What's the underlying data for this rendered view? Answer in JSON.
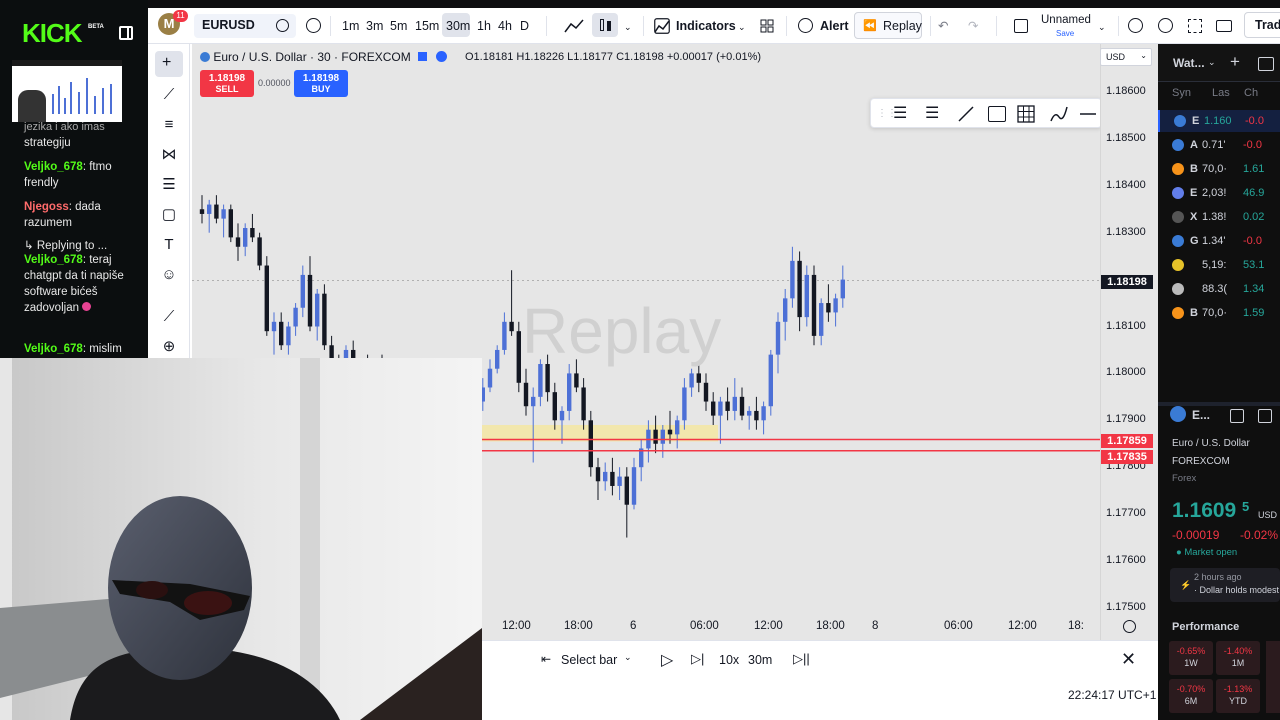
{
  "kick": {
    "logo": "KICK",
    "beta": "BETA",
    "cut_text": "jezika i ako imas",
    "messages": [
      {
        "text": "strategiju"
      },
      {
        "user": "Veljko_678",
        "text": ": ftmo frendly"
      },
      {
        "user": "Njegoss",
        "text": ": dada razumem"
      },
      {
        "reply": "Replying to ..."
      },
      {
        "user": "Veljko_678",
        "text": ": teraj chatgpt da ti napiše software bićeš zadovoljan"
      },
      {
        "user": "Veljko_678",
        "text": ": mislim"
      }
    ],
    "colors": {
      "accent": "#53fc18",
      "user_green": "#53fc18",
      "user_red": "#ff6b6b"
    }
  },
  "topbar": {
    "avatar": "M",
    "notifications": "11",
    "symbol": "EURUSD",
    "timeframes": [
      "1m",
      "3m",
      "5m",
      "15m",
      "30m",
      "1h",
      "4h",
      "D"
    ],
    "active_timeframe": "30m",
    "indicators": "Indicators",
    "alert": "Alert",
    "replay": "Replay",
    "layout_name": "Unnamed",
    "layout_save": "Save",
    "trade": "Trade"
  },
  "chart": {
    "title": "Euro / U.S. Dollar · 30 · FOREXCOM",
    "ohlc": "O1.18181 H1.18226 L1.18177 C1.18198 +0.00017 (+0.01%)",
    "sell_price": "1.18198",
    "sell_label": "SELL",
    "buy_price": "1.18198",
    "buy_label": "BUY",
    "spread": "0.00000",
    "watermark": "Replay",
    "currency": "USD",
    "current_price": "1.18198",
    "line1": "1.17859",
    "line2": "1.17835",
    "price_ticks": [
      "1.18600",
      "1.18500",
      "1.18400",
      "1.18300",
      "1.18100",
      "1.18000",
      "1.17900",
      "1.17800",
      "1.17700",
      "1.17600",
      "1.17500"
    ],
    "time_ticks": [
      "12:00",
      "18:00",
      "6",
      "06:00",
      "12:00",
      "18:00",
      "8",
      "06:00",
      "12:00",
      "18:"
    ]
  },
  "chart_data": {
    "type": "candlestick",
    "title": "Euro / U.S. Dollar · 30 · FOREXCOM",
    "ylim": [
      1.175,
      1.1868
    ],
    "current": 1.18198,
    "horizontal_lines": [
      1.17859,
      1.17835
    ],
    "zone": [
      1.17855,
      1.1789
    ],
    "candles": [
      [
        1.1835,
        1.1838,
        1.1832,
        1.1834
      ],
      [
        1.1834,
        1.1837,
        1.183,
        1.1836
      ],
      [
        1.1836,
        1.1838,
        1.1832,
        1.1833
      ],
      [
        1.1833,
        1.1836,
        1.1829,
        1.1835
      ],
      [
        1.1835,
        1.1836,
        1.1828,
        1.1829
      ],
      [
        1.1829,
        1.1832,
        1.1824,
        1.1827
      ],
      [
        1.1827,
        1.1832,
        1.1825,
        1.1831
      ],
      [
        1.1831,
        1.1834,
        1.1828,
        1.1829
      ],
      [
        1.1829,
        1.183,
        1.1822,
        1.1823
      ],
      [
        1.1823,
        1.1825,
        1.1808,
        1.1809
      ],
      [
        1.1809,
        1.1813,
        1.1804,
        1.1811
      ],
      [
        1.1811,
        1.1813,
        1.1805,
        1.1806
      ],
      [
        1.1806,
        1.1811,
        1.1804,
        1.181
      ],
      [
        1.181,
        1.1815,
        1.1808,
        1.1814
      ],
      [
        1.1814,
        1.1823,
        1.1812,
        1.1821
      ],
      [
        1.1821,
        1.1825,
        1.1809,
        1.181
      ],
      [
        1.181,
        1.1818,
        1.1807,
        1.1817
      ],
      [
        1.1817,
        1.1819,
        1.1805,
        1.1806
      ],
      [
        1.1806,
        1.1808,
        1.18,
        1.1802
      ],
      [
        1.1802,
        1.1804,
        1.1797,
        1.1799
      ],
      [
        1.1799,
        1.1806,
        1.1798,
        1.1805
      ],
      [
        1.1805,
        1.1807,
        1.1799,
        1.18
      ],
      [
        1.18,
        1.1802,
        1.1796,
        1.1801
      ],
      [
        1.1801,
        1.1804,
        1.1797,
        1.1798
      ],
      [
        1.1798,
        1.1803,
        1.1796,
        1.1802
      ],
      [
        1.1802,
        1.1804,
        1.1797,
        1.1799
      ],
      [
        1.1799,
        1.1802,
        1.1795,
        1.1801
      ],
      [
        1.1801,
        1.1803,
        1.1797,
        1.1798
      ],
      [
        1.1798,
        1.1801,
        1.1796,
        1.18
      ],
      [
        1.18,
        1.1802,
        1.1797,
        1.1799
      ],
      [
        1.1799,
        1.18,
        1.1791,
        1.1792
      ],
      [
        1.1792,
        1.1795,
        1.1788,
        1.1794
      ],
      [
        1.1794,
        1.1795,
        1.1789,
        1.179
      ],
      [
        1.179,
        1.1792,
        1.178,
        1.1781
      ],
      [
        1.1781,
        1.179,
        1.178,
        1.1789
      ],
      [
        1.1789,
        1.1799,
        1.1787,
        1.1798
      ],
      [
        1.1798,
        1.1803,
        1.1794,
        1.1796
      ],
      [
        1.1796,
        1.1798,
        1.179,
        1.1792
      ],
      [
        1.1792,
        1.1795,
        1.1789,
        1.1794
      ],
      [
        1.1794,
        1.1799,
        1.1792,
        1.1797
      ],
      [
        1.1797,
        1.1803,
        1.1796,
        1.1801
      ],
      [
        1.1801,
        1.1806,
        1.18,
        1.1805
      ],
      [
        1.1805,
        1.1813,
        1.1804,
        1.1811
      ],
      [
        1.1811,
        1.1822,
        1.1808,
        1.1809
      ],
      [
        1.1809,
        1.1811,
        1.1796,
        1.1798
      ],
      [
        1.1798,
        1.1801,
        1.1791,
        1.1793
      ],
      [
        1.1793,
        1.1797,
        1.1781,
        1.1795
      ],
      [
        1.1795,
        1.1803,
        1.1793,
        1.1802
      ],
      [
        1.1802,
        1.1804,
        1.1794,
        1.1796
      ],
      [
        1.1796,
        1.1798,
        1.1788,
        1.179
      ],
      [
        1.179,
        1.1793,
        1.1785,
        1.1792
      ],
      [
        1.1792,
        1.1802,
        1.179,
        1.18
      ],
      [
        1.18,
        1.1803,
        1.1796,
        1.1797
      ],
      [
        1.1797,
        1.1799,
        1.1788,
        1.179
      ],
      [
        1.179,
        1.1792,
        1.1778,
        1.178
      ],
      [
        1.178,
        1.1782,
        1.1773,
        1.1777
      ],
      [
        1.1777,
        1.1781,
        1.1775,
        1.1779
      ],
      [
        1.1779,
        1.1782,
        1.1774,
        1.1776
      ],
      [
        1.1776,
        1.178,
        1.1773,
        1.1778
      ],
      [
        1.1778,
        1.178,
        1.1765,
        1.1772
      ],
      [
        1.1772,
        1.1782,
        1.1771,
        1.178
      ],
      [
        1.178,
        1.1786,
        1.1777,
        1.1784
      ],
      [
        1.1784,
        1.179,
        1.1781,
        1.1788
      ],
      [
        1.1788,
        1.1791,
        1.1783,
        1.1785
      ],
      [
        1.1785,
        1.1789,
        1.1782,
        1.1788
      ],
      [
        1.1788,
        1.1792,
        1.1785,
        1.1787
      ],
      [
        1.1787,
        1.1791,
        1.1784,
        1.179
      ],
      [
        1.179,
        1.1799,
        1.1788,
        1.1797
      ],
      [
        1.1797,
        1.1801,
        1.1795,
        1.18
      ],
      [
        1.18,
        1.1802,
        1.1796,
        1.1798
      ],
      [
        1.1798,
        1.18,
        1.1792,
        1.1794
      ],
      [
        1.1794,
        1.1796,
        1.1789,
        1.1791
      ],
      [
        1.1791,
        1.1795,
        1.1785,
        1.1794
      ],
      [
        1.1794,
        1.1797,
        1.179,
        1.1792
      ],
      [
        1.1792,
        1.1799,
        1.179,
        1.1795
      ],
      [
        1.1795,
        1.1797,
        1.179,
        1.1791
      ],
      [
        1.1791,
        1.1793,
        1.1788,
        1.1792
      ],
      [
        1.1792,
        1.1795,
        1.1788,
        1.179
      ],
      [
        1.179,
        1.1794,
        1.1787,
        1.1793
      ],
      [
        1.1793,
        1.1805,
        1.1791,
        1.1804
      ],
      [
        1.1804,
        1.1813,
        1.18,
        1.1811
      ],
      [
        1.1811,
        1.1818,
        1.1807,
        1.1816
      ],
      [
        1.1816,
        1.1827,
        1.1814,
        1.1824
      ],
      [
        1.1824,
        1.1826,
        1.1809,
        1.1812
      ],
      [
        1.1812,
        1.1823,
        1.181,
        1.1821
      ],
      [
        1.1821,
        1.1823,
        1.1806,
        1.1808
      ],
      [
        1.1808,
        1.1816,
        1.1806,
        1.1815
      ],
      [
        1.1815,
        1.1819,
        1.1811,
        1.1813
      ],
      [
        1.1813,
        1.1817,
        1.181,
        1.1816
      ],
      [
        1.1816,
        1.1823,
        1.1814,
        1.182
      ]
    ]
  },
  "drawing_toolbar": {
    "tools": [
      "settings-lines",
      "settings-alt",
      "trendline",
      "rectangle",
      "grid",
      "brush",
      "line"
    ]
  },
  "replay_bar": {
    "select_bar": "Select bar",
    "speed": "10x",
    "interval": "30m",
    "time": "22:24:17 UTC+1"
  },
  "watchlist": {
    "header": "Wat...",
    "columns": [
      "Syn",
      "Las",
      "Ch"
    ],
    "rows": [
      {
        "sym": "E",
        "last": "1.160",
        "chg": "-0.0",
        "icon_color": "#3a7bd5",
        "chg_color": "#f23645",
        "last_color": "#26a69a"
      },
      {
        "sym": "A",
        "last": "0.71'",
        "chg": "-0.0",
        "icon_color": "#3a7bd5",
        "chg_color": "#f23645",
        "last_color": "#d1d4dc"
      },
      {
        "sym": "B",
        "last": "70,0·",
        "chg": "1.61",
        "icon_color": "#f7931a",
        "chg_color": "#26a69a",
        "last_color": "#d1d4dc"
      },
      {
        "sym": "E",
        "last": "2,03!",
        "chg": "46.9",
        "icon_color": "#627eea",
        "chg_color": "#26a69a",
        "last_color": "#d1d4dc"
      },
      {
        "sym": "X",
        "last": "1.38!",
        "chg": "0.02",
        "icon_color": "#555555",
        "chg_color": "#26a69a",
        "last_color": "#d1d4dc"
      },
      {
        "sym": "G",
        "last": "1.34'",
        "chg": "-0.0",
        "icon_color": "#3a7bd5",
        "chg_color": "#f23645",
        "last_color": "#d1d4dc"
      },
      {
        "sym": "",
        "last": "5,19:",
        "chg": "53.1",
        "icon_color": "#e6c229",
        "chg_color": "#26a69a",
        "last_color": "#d1d4dc"
      },
      {
        "sym": "",
        "last": "88.3(",
        "chg": "1.34",
        "icon_color": "#bbbbbb",
        "chg_color": "#26a69a",
        "last_color": "#d1d4dc"
      },
      {
        "sym": "B",
        "last": "70,0·",
        "chg": "1.59",
        "icon_color": "#f7931a",
        "chg_color": "#26a69a",
        "last_color": "#d1d4dc"
      }
    ],
    "detail": {
      "sym": "E...",
      "name": "Euro / U.S. Dollar",
      "exchange": "FOREXCOM",
      "type": "Forex",
      "price": "1.1609",
      "price_small": "5",
      "currency": "USD",
      "change": "-0.00019",
      "change_pct": "-0.02%",
      "market": "Market open",
      "news_time": "2 hours ago",
      "news_text": "· Dollar holds modest gain...",
      "performance": "Performance",
      "perf": [
        {
          "value": "-0.65%",
          "label": "1W"
        },
        {
          "value": "-1.40%",
          "label": "1M"
        },
        {
          "value": "-0.70%",
          "label": "6M"
        },
        {
          "value": "-1.13%",
          "label": "YTD"
        }
      ]
    }
  }
}
